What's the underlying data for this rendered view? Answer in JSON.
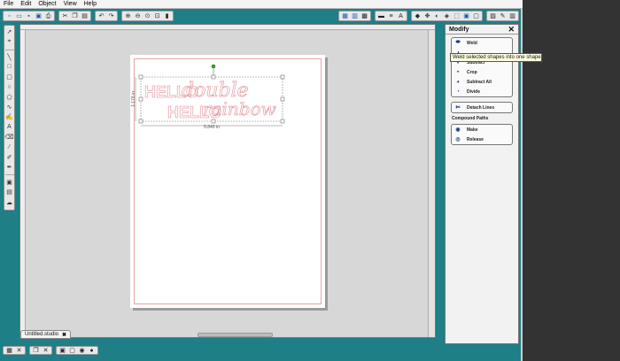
{
  "menu": [
    "File",
    "Edit",
    "Object",
    "View",
    "Help"
  ],
  "toolbar": {
    "icons": [
      "new-icon",
      "open-icon",
      "save-icon",
      "save-as-icon",
      "print-icon",
      "cut-icon",
      "copy-icon",
      "paste-icon",
      "undo-icon",
      "redo-icon",
      "zoom-in-icon",
      "zoom-out-icon",
      "zoom-select-icon",
      "zoom-fit-icon",
      "drag-icon"
    ],
    "right_icons": [
      "grid-icon",
      "align-icon",
      "replicate-icon",
      "offset-icon",
      "trace-icon",
      "text-style-icon",
      "line-style-icon",
      "fill-color-icon",
      "gradient-icon",
      "pattern-icon",
      "transform-icon",
      "modify-icon",
      "design-page-icon",
      "send-icon"
    ]
  },
  "tab": {
    "label": "Untitled.studio",
    "close": "✖"
  },
  "design": {
    "selection_width": "5.846 in",
    "selection_height": "1.178 in",
    "word1": "HELLO",
    "word2": "double",
    "word3": "HELLO",
    "word4": "rainbow",
    "stroke_color": "#e48a94"
  },
  "panel": {
    "title": "Modify",
    "close": "✕",
    "group1": [
      "Weld",
      "Subtract",
      "Crop",
      "Subtract All",
      "Divide"
    ],
    "group2": [
      "Detach Lines"
    ],
    "section_compound": "Compound Paths",
    "group3": [
      "Make",
      "Release"
    ]
  },
  "tooltip": "Weld selected shapes into one shape",
  "colors": {
    "accent": "#1e7f86",
    "design_stroke": "#e48a94"
  }
}
